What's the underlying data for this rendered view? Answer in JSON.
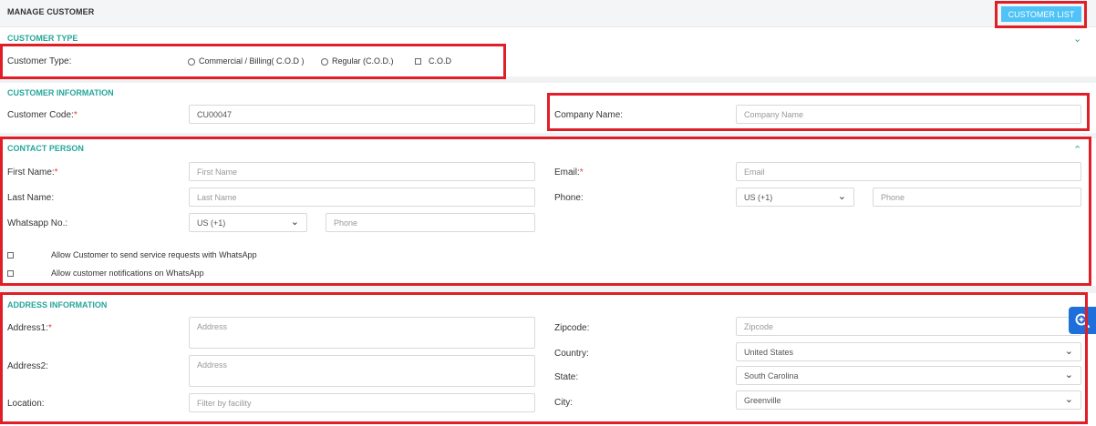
{
  "header": {
    "title": "MANAGE CUSTOMER",
    "customer_list_label": "CUSTOMER LIST"
  },
  "customer_type": {
    "section_title": "CUSTOMER TYPE",
    "label": "Customer Type:",
    "options": [
      "Commercial / Billing( C.O.D )",
      "Regular (C.O.D.)",
      "C.O.D"
    ]
  },
  "customer_info": {
    "section_title": "CUSTOMER INFORMATION",
    "code_label": "Customer Code:",
    "code_value": "CU00047",
    "company_label": "Company Name:",
    "company_placeholder": "Company Name"
  },
  "contact": {
    "section_title": "CONTACT PERSON",
    "first_name_label": "First Name:",
    "first_name_placeholder": "First Name",
    "last_name_label": "Last Name:",
    "last_name_placeholder": "Last Name",
    "whatsapp_label": "Whatsapp No.:",
    "whatsapp_country": "US (+1)",
    "whatsapp_placeholder": "Phone",
    "email_label": "Email:",
    "email_placeholder": "Email",
    "phone_label": "Phone:",
    "phone_country": "US (+1)",
    "phone_placeholder": "Phone",
    "allow_service_label": "Allow Customer to send service requests with WhatsApp",
    "allow_notif_label": "Allow customer notifications on WhatsApp"
  },
  "address": {
    "section_title": "ADDRESS INFORMATION",
    "address1_label": "Address1:",
    "address1_placeholder": "Address",
    "address2_label": "Address2:",
    "address2_placeholder": "Address",
    "location_label": "Location:",
    "location_placeholder": "Filter by facility",
    "zipcode_label": "Zipcode:",
    "zipcode_placeholder": "Zipcode",
    "country_label": "Country:",
    "country_value": "United States",
    "state_label": "State:",
    "state_value": "South Carolina",
    "city_label": "City:",
    "city_value": "Greenville"
  },
  "colors": {
    "accent": "#26a69a",
    "button": "#4fc3f7",
    "highlight": "#e01e27",
    "required": "#e53935",
    "zoom": "#1e6fd9"
  },
  "icons": [
    "chevron-down-icon",
    "chevron-up-icon",
    "zoom-in-icon"
  ]
}
